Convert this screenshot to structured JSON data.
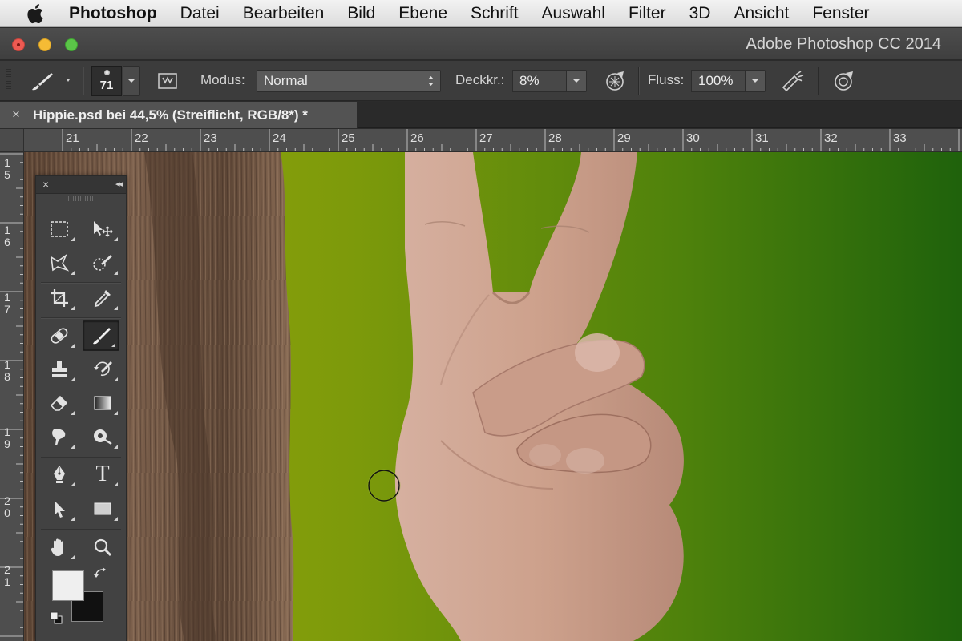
{
  "menubar": {
    "app_name": "Photoshop",
    "items": [
      "Datei",
      "Bearbeiten",
      "Bild",
      "Ebene",
      "Schrift",
      "Auswahl",
      "Filter",
      "3D",
      "Ansicht",
      "Fenster"
    ]
  },
  "window": {
    "title": "Adobe Photoshop CC 2014"
  },
  "options": {
    "brush_size": "71",
    "mode_label": "Modus:",
    "mode_value": "Normal",
    "opacity_label": "Deckkr.:",
    "opacity_value": "8%",
    "flow_label": "Fluss:",
    "flow_value": "100%"
  },
  "document": {
    "tab_close": "×",
    "tab_title": "Hippie.psd bei 44,5% (Streiflicht, RGB/8*) *"
  },
  "rulers": {
    "horizontal": [
      "21",
      "22",
      "23",
      "24",
      "25",
      "26",
      "27",
      "28",
      "29",
      "30",
      "31",
      "32",
      "33"
    ],
    "vertical": [
      "1\n5",
      "1\n6",
      "1\n7",
      "1\n8",
      "1\n9",
      "2\n0",
      "2\n1"
    ]
  },
  "tools_panel": {
    "close": "×",
    "collapse": "◂◂",
    "tools": [
      "rect-marquee",
      "move",
      "lasso",
      "quick-select",
      "crop",
      "eyedropper",
      "healing-brush",
      "brush",
      "clone-stamp",
      "history-brush",
      "eraser",
      "gradient",
      "smudge",
      "dodge",
      "pen",
      "type",
      "path-select",
      "rectangle-shape",
      "hand",
      "zoom"
    ],
    "active_tool": "brush",
    "type_glyph": "T",
    "foreground_color": "#efefef",
    "background_color": "#111111"
  },
  "colors": {
    "canvas_green_light": "#86a20c",
    "canvas_green_dark": "#256a0c",
    "hair": "#6e5443",
    "skin": "#cfa48d"
  }
}
